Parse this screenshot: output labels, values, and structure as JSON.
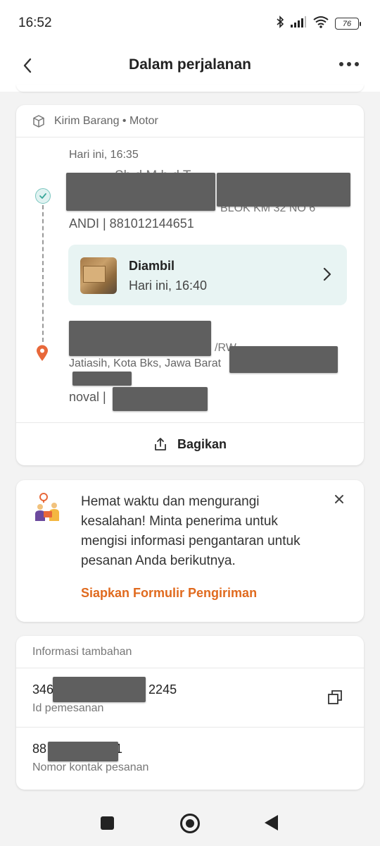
{
  "status_bar": {
    "time": "16:52",
    "battery": "76",
    "icons": [
      "bluetooth-icon",
      "signal-icon",
      "wifi-icon",
      "battery-icon"
    ]
  },
  "header": {
    "title": "Dalam perjalanan",
    "back_icon": "chevron-left-icon",
    "more_icon": "more-horizontal-icon"
  },
  "order_card": {
    "service": "Kirim Barang • Motor",
    "timeline": {
      "sender_time": "Hari ini, 16:35",
      "sender_title_partial": "Sh                 d M h d T",
      "sender_address_partial": "BLOK KM 32 NO 6",
      "sender_contact": "ANDI | 881012144651",
      "pickup": {
        "title": "Diambil",
        "time": "Hari ini, 16:40"
      },
      "receiver_address_partial": "Jatiasih, Kota Bks, Jawa Barat",
      "receiver_contact": "noval |"
    },
    "share_label": "Bagikan"
  },
  "promo_card": {
    "text": "Hemat waktu dan mengurangi kesalahan! Minta penerima untuk mengisi informasi pengantaran untuk pesanan Anda berikutnya.",
    "link": "Siapkan Formulir Pengiriman",
    "link_color": "#e06a1e"
  },
  "info_card": {
    "header": "Informasi tambahan",
    "rows": [
      {
        "value_prefix": "346",
        "value_suffix": "2245",
        "label": "Id pemesanan"
      },
      {
        "value_prefix": "88",
        "value_suffix": "1",
        "label": "Nomor kontak pesanan"
      }
    ]
  },
  "colors": {
    "accent_orange": "#e06a1e",
    "teal_check": "#7ac6bf",
    "pickup_bg": "#e8f4f3"
  }
}
